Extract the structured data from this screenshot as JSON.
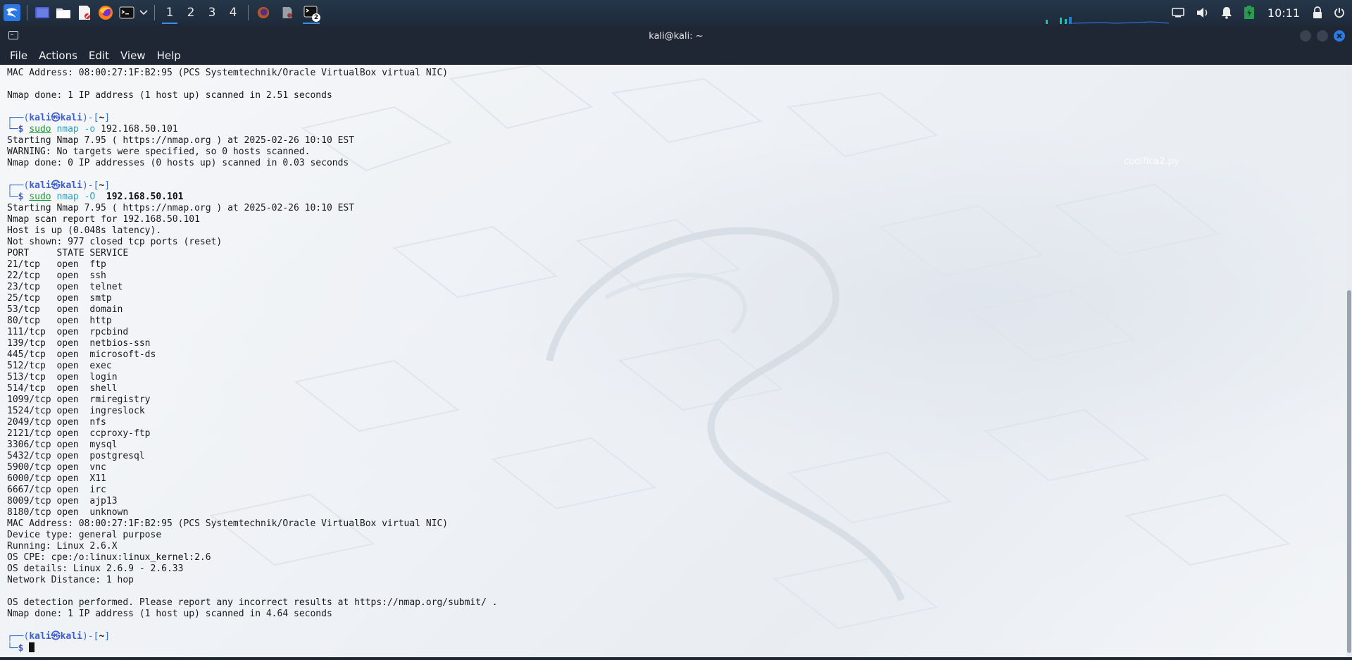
{
  "taskbar": {
    "workspaces": [
      "1",
      "2",
      "3",
      "4"
    ],
    "active_workspace": "1",
    "active_task_badge": "2",
    "clock": "10:11",
    "launcher_icons": [
      "kali-menu-icon",
      "desktop-icon",
      "file-manager-icon",
      "text-editor-icon",
      "firefox-icon",
      "terminal-icon",
      "dropdown-chevron-icon"
    ],
    "task_icons": [
      "firefox-task-icon",
      "editor-task-icon",
      "terminal-task-icon"
    ],
    "tray_icons": [
      "display-icon",
      "volume-icon",
      "notifications-icon",
      "battery-icon",
      "lock-icon",
      "power-icon"
    ]
  },
  "window": {
    "title": "kali@kali: ~"
  },
  "menu": {
    "items": [
      "File",
      "Actions",
      "Edit",
      "View",
      "Help"
    ]
  },
  "desktop": {
    "watermark": "codifica2.py"
  },
  "terminal": {
    "lines": [
      {
        "kind": "text",
        "text": "MAC Address: 08:00:27:1F:B2:95 (PCS Systemtechnik/Oracle VirtualBox virtual NIC)"
      },
      {
        "kind": "text",
        "text": ""
      },
      {
        "kind": "text",
        "text": "Nmap done: 1 IP address (1 host up) scanned in 2.51 seconds"
      },
      {
        "kind": "text",
        "text": ""
      },
      {
        "kind": "prompt",
        "user": "kali",
        "host": "kali",
        "dir": "~"
      },
      {
        "kind": "command",
        "sudo": "sudo",
        "bin": "nmap",
        "flag": "-o",
        "target": "192.168.50.101",
        "bold_target": false
      },
      {
        "kind": "text",
        "text": "Starting Nmap 7.95 ( https://nmap.org ) at 2025-02-26 10:10 EST"
      },
      {
        "kind": "text",
        "text": "WARNING: No targets were specified, so 0 hosts scanned."
      },
      {
        "kind": "text",
        "text": "Nmap done: 0 IP addresses (0 hosts up) scanned in 0.03 seconds"
      },
      {
        "kind": "text",
        "text": ""
      },
      {
        "kind": "prompt",
        "user": "kali",
        "host": "kali",
        "dir": "~"
      },
      {
        "kind": "command",
        "sudo": "sudo",
        "bin": "nmap",
        "flag": "-O ",
        "target": "192.168.50.101",
        "bold_target": true
      },
      {
        "kind": "text",
        "text": "Starting Nmap 7.95 ( https://nmap.org ) at 2025-02-26 10:10 EST"
      },
      {
        "kind": "text",
        "text": "Nmap scan report for 192.168.50.101"
      },
      {
        "kind": "text",
        "text": "Host is up (0.048s latency)."
      },
      {
        "kind": "text",
        "text": "Not shown: 977 closed tcp ports (reset)"
      },
      {
        "kind": "text",
        "text": "PORT     STATE SERVICE"
      },
      {
        "kind": "text",
        "text": "21/tcp   open  ftp"
      },
      {
        "kind": "text",
        "text": "22/tcp   open  ssh"
      },
      {
        "kind": "text",
        "text": "23/tcp   open  telnet"
      },
      {
        "kind": "text",
        "text": "25/tcp   open  smtp"
      },
      {
        "kind": "text",
        "text": "53/tcp   open  domain"
      },
      {
        "kind": "text",
        "text": "80/tcp   open  http"
      },
      {
        "kind": "text",
        "text": "111/tcp  open  rpcbind"
      },
      {
        "kind": "text",
        "text": "139/tcp  open  netbios-ssn"
      },
      {
        "kind": "text",
        "text": "445/tcp  open  microsoft-ds"
      },
      {
        "kind": "text",
        "text": "512/tcp  open  exec"
      },
      {
        "kind": "text",
        "text": "513/tcp  open  login"
      },
      {
        "kind": "text",
        "text": "514/tcp  open  shell"
      },
      {
        "kind": "text",
        "text": "1099/tcp open  rmiregistry"
      },
      {
        "kind": "text",
        "text": "1524/tcp open  ingreslock"
      },
      {
        "kind": "text",
        "text": "2049/tcp open  nfs"
      },
      {
        "kind": "text",
        "text": "2121/tcp open  ccproxy-ftp"
      },
      {
        "kind": "text",
        "text": "3306/tcp open  mysql"
      },
      {
        "kind": "text",
        "text": "5432/tcp open  postgresql"
      },
      {
        "kind": "text",
        "text": "5900/tcp open  vnc"
      },
      {
        "kind": "text",
        "text": "6000/tcp open  X11"
      },
      {
        "kind": "text",
        "text": "6667/tcp open  irc"
      },
      {
        "kind": "text",
        "text": "8009/tcp open  ajp13"
      },
      {
        "kind": "text",
        "text": "8180/tcp open  unknown"
      },
      {
        "kind": "text",
        "text": "MAC Address: 08:00:27:1F:B2:95 (PCS Systemtechnik/Oracle VirtualBox virtual NIC)"
      },
      {
        "kind": "text",
        "text": "Device type: general purpose"
      },
      {
        "kind": "text",
        "text": "Running: Linux 2.6.X"
      },
      {
        "kind": "text",
        "text": "OS CPE: cpe:/o:linux:linux_kernel:2.6"
      },
      {
        "kind": "text",
        "text": "OS details: Linux 2.6.9 - 2.6.33"
      },
      {
        "kind": "text",
        "text": "Network Distance: 1 hop"
      },
      {
        "kind": "text",
        "text": ""
      },
      {
        "kind": "text",
        "text": "OS detection performed. Please report any incorrect results at https://nmap.org/submit/ ."
      },
      {
        "kind": "text",
        "text": "Nmap done: 1 IP address (1 host up) scanned in 4.64 seconds"
      },
      {
        "kind": "text",
        "text": ""
      },
      {
        "kind": "prompt",
        "user": "kali",
        "host": "kali",
        "dir": "~"
      },
      {
        "kind": "input"
      }
    ]
  },
  "colors": {
    "prompt_box": "#2f6fd6",
    "prompt_user": "#3d5fd0",
    "sudo": "#1e9a3a",
    "binary": "#27a3c9",
    "active_indicator": "#3a8ee6",
    "close_button": "#2d7be0"
  }
}
